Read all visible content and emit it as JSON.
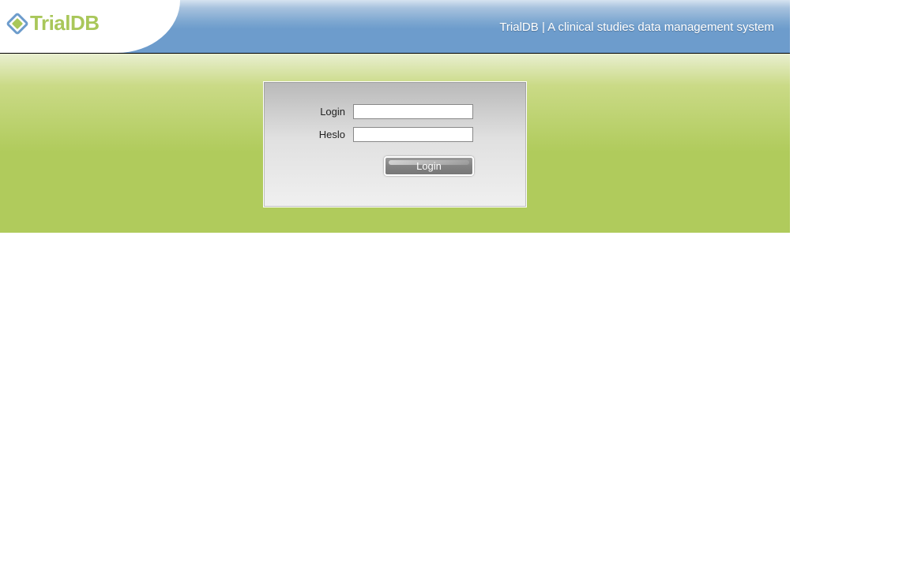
{
  "logo": {
    "brand": "TrialDB"
  },
  "header": {
    "tagline": "TrialDB | A clinical studies data management system"
  },
  "login": {
    "username_label": "Login",
    "password_label": "Heslo",
    "submit_label": "Login"
  }
}
